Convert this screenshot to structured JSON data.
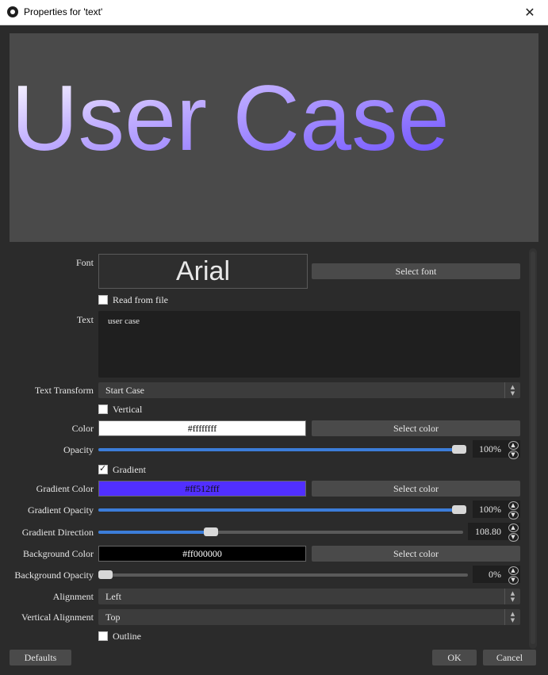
{
  "window": {
    "title": "Properties for 'text'"
  },
  "preview": {
    "text": "User Case"
  },
  "font": {
    "label": "Font",
    "value": "Arial",
    "select_label": "Select font"
  },
  "read_from_file": {
    "label": "Read from file",
    "checked": false
  },
  "text_field": {
    "label": "Text",
    "value": "user case"
  },
  "text_transform": {
    "label": "Text Transform",
    "value": "Start Case"
  },
  "vertical": {
    "label": "Vertical",
    "checked": false
  },
  "color": {
    "label": "Color",
    "value": "#ffffffff",
    "select_label": "Select color",
    "swatch": "#ffffff"
  },
  "opacity": {
    "label": "Opacity",
    "value": "100%",
    "level": 100
  },
  "gradient": {
    "label": "Gradient",
    "checked": true
  },
  "gradient_color": {
    "label": "Gradient Color",
    "value": "#ff512fff",
    "select_label": "Select color",
    "swatch": "#512fff"
  },
  "gradient_opacity": {
    "label": "Gradient Opacity",
    "value": "100%",
    "level": 100
  },
  "gradient_direction": {
    "label": "Gradient Direction",
    "value": "108.80",
    "level": 30.2
  },
  "background_color": {
    "label": "Background Color",
    "value": "#ff000000",
    "select_label": "Select color",
    "swatch": "#000000"
  },
  "background_opacity": {
    "label": "Background Opacity",
    "value": "0%",
    "level": 0
  },
  "alignment": {
    "label": "Alignment",
    "value": "Left"
  },
  "vertical_alignment": {
    "label": "Vertical Alignment",
    "value": "Top"
  },
  "outline": {
    "label": "Outline",
    "checked": false
  },
  "footer": {
    "defaults_label": "Defaults",
    "ok_label": "OK",
    "cancel_label": "Cancel"
  },
  "colors": {
    "accent": "#3c7dd9",
    "panel": "#2b2b2b",
    "button": "#4a4a4a"
  }
}
